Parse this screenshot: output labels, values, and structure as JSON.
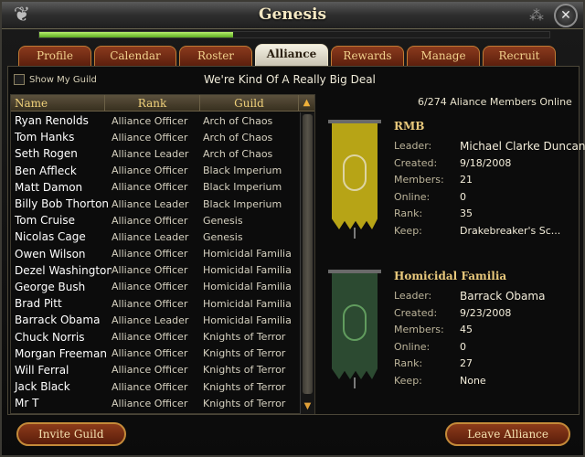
{
  "window": {
    "title": "Genesis",
    "close_glyph": "✕",
    "left_ornament": "❦",
    "right_ornament": "⁂"
  },
  "progress": 0.38,
  "tabs": [
    {
      "label": "Profile",
      "active": false
    },
    {
      "label": "Calendar",
      "active": false
    },
    {
      "label": "Roster",
      "active": false
    },
    {
      "label": "Alliance",
      "active": true
    },
    {
      "label": "Rewards",
      "active": false
    },
    {
      "label": "Manage",
      "active": false
    },
    {
      "label": "Recruit",
      "active": false
    }
  ],
  "toolbar": {
    "show_my_guild_label": "Show My Guild",
    "show_my_guild_checked": false
  },
  "guild_motto": "We're Kind Of A Really Big Deal",
  "roster": {
    "columns": {
      "name": "Name",
      "rank": "Rank",
      "guild": "Guild"
    },
    "sort_glyph": "▲",
    "rows": [
      {
        "name": "Ryan Renolds",
        "rank": "Alliance Officer",
        "guild": "Arch of Chaos"
      },
      {
        "name": "Tom Hanks",
        "rank": "Alliance Officer",
        "guild": "Arch of Chaos"
      },
      {
        "name": "Seth Rogen",
        "rank": "Alliance Leader",
        "guild": "Arch of Chaos"
      },
      {
        "name": "Ben Affleck",
        "rank": "Alliance Officer",
        "guild": "Black Imperium"
      },
      {
        "name": "Matt Damon",
        "rank": "Alliance Officer",
        "guild": "Black Imperium"
      },
      {
        "name": "Billy Bob Thorton",
        "rank": "Alliance Leader",
        "guild": "Black Imperium"
      },
      {
        "name": "Tom Cruise",
        "rank": "Alliance Officer",
        "guild": "Genesis"
      },
      {
        "name": "Nicolas Cage",
        "rank": "Alliance Leader",
        "guild": "Genesis"
      },
      {
        "name": "Owen Wilson",
        "rank": "Alliance Officer",
        "guild": "Homicidal Familia"
      },
      {
        "name": "Dezel Washington",
        "rank": "Alliance Officer",
        "guild": "Homicidal Familia"
      },
      {
        "name": "George Bush",
        "rank": "Alliance Officer",
        "guild": "Homicidal Familia"
      },
      {
        "name": "Brad Pitt",
        "rank": "Alliance Officer",
        "guild": "Homicidal Familia"
      },
      {
        "name": "Barrack Obama",
        "rank": "Alliance Leader",
        "guild": "Homicidal Familia"
      },
      {
        "name": "Chuck Norris",
        "rank": "Alliance Officer",
        "guild": "Knights of Terror"
      },
      {
        "name": "Morgan Freeman",
        "rank": "Alliance Officer",
        "guild": "Knights of Terror"
      },
      {
        "name": "Will Ferral",
        "rank": "Alliance Officer",
        "guild": "Knights of Terror"
      },
      {
        "name": "Jack Black",
        "rank": "Alliance Officer",
        "guild": "Knights of Terror"
      },
      {
        "name": "Mr T",
        "rank": "Alliance Officer",
        "guild": "Knights of Terror"
      }
    ]
  },
  "online_count": "6/274 Aliance Members Online",
  "alliances": [
    {
      "name": "RMB",
      "banner_color": "#b7a416",
      "banner_accent": "#e6e0c8",
      "banner_icon": "serpent-icon",
      "fields": [
        {
          "label": "Leader:",
          "value": "Michael Clarke Duncan"
        },
        {
          "label": "Created:",
          "value": "9/18/2008"
        },
        {
          "label": "Members:",
          "value": "21"
        },
        {
          "label": "Online:",
          "value": "0"
        },
        {
          "label": "Rank:",
          "value": "35"
        },
        {
          "label": "Keep:",
          "value": "Drakebreaker's Sc..."
        }
      ]
    },
    {
      "name": "Homicidal Familia",
      "banner_color": "#2c4a31",
      "banner_accent": "#6fb06a",
      "banner_icon": "sun-skull-icon",
      "fields": [
        {
          "label": "Leader:",
          "value": "Barrack Obama"
        },
        {
          "label": "Created:",
          "value": "9/23/2008"
        },
        {
          "label": "Members:",
          "value": "45"
        },
        {
          "label": "Online:",
          "value": "0"
        },
        {
          "label": "Rank:",
          "value": "27"
        },
        {
          "label": "Keep:",
          "value": "None"
        }
      ]
    }
  ],
  "buttons": {
    "invite_guild": "Invite Guild",
    "leave_alliance": "Leave Alliance"
  },
  "colors": {
    "accent": "#e9c97c",
    "tab_bg": "#7a2f14",
    "progress": "#8fd048"
  }
}
